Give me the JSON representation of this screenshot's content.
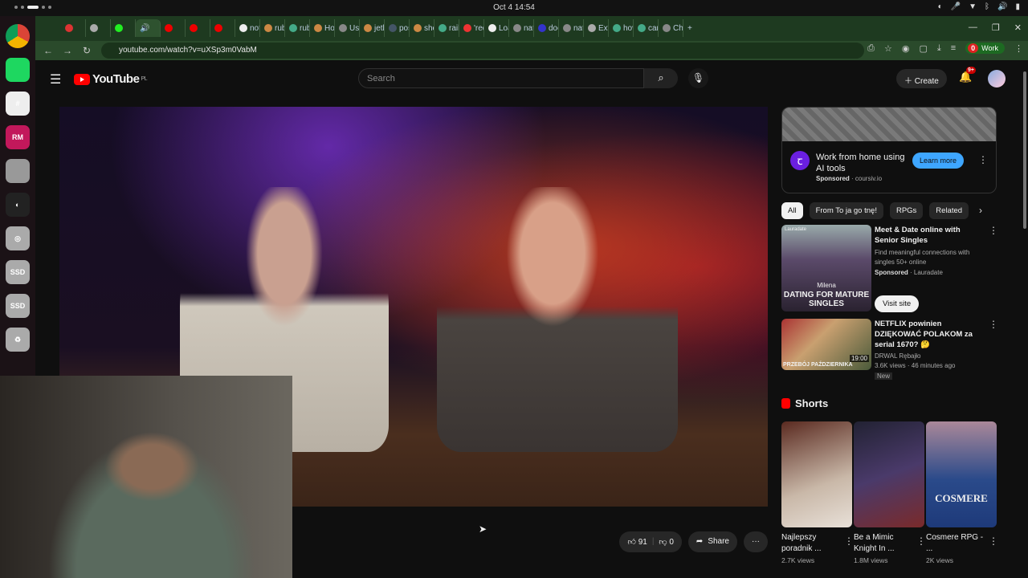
{
  "system": {
    "clock": "Oct 4  14:54",
    "tray": [
      "◐",
      "🎤",
      "▼",
      "ᛒ",
      "🔊",
      "▮"
    ]
  },
  "dock": [
    {
      "name": "chrome",
      "label": "",
      "color": "#ddd"
    },
    {
      "name": "spotify",
      "label": "",
      "color": "#1ed760"
    },
    {
      "name": "slack",
      "label": "#",
      "color": "#eee"
    },
    {
      "name": "rubymine",
      "label": "RM",
      "color": "#c2185b"
    },
    {
      "name": "files",
      "label": "",
      "color": "#999"
    },
    {
      "name": "obs",
      "label": "◐",
      "color": "#222"
    },
    {
      "name": "disc",
      "label": "◎",
      "color": "#aaa"
    },
    {
      "name": "ssd-1",
      "label": "SSD",
      "color": "#aaa"
    },
    {
      "name": "ssd-2",
      "label": "SSD",
      "color": "#aaa"
    },
    {
      "name": "trash",
      "label": "♻",
      "color": "#aaa"
    }
  ],
  "browser": {
    "tabs": [
      {
        "label": "",
        "icon": "#d33"
      },
      {
        "label": "",
        "icon": "#aaa"
      },
      {
        "label": "",
        "icon": "#2e2"
      },
      {
        "label": "🔊",
        "icon": "",
        "active": true
      },
      {
        "label": "",
        "icon": "#e00"
      },
      {
        "label": "",
        "icon": "#e00"
      },
      {
        "label": "",
        "icon": "#e00"
      },
      {
        "label": "not",
        "icon": "#eee"
      },
      {
        "label": "rub",
        "icon": "#c84"
      },
      {
        "label": "rub",
        "icon": "#4a8"
      },
      {
        "label": "Hov",
        "icon": "#c84"
      },
      {
        "label": "Ust",
        "icon": "#888"
      },
      {
        "label": "jetb",
        "icon": "#c84"
      },
      {
        "label": "pos",
        "icon": "#456"
      },
      {
        "label": "she",
        "icon": "#c84"
      },
      {
        "label": "rails",
        "icon": "#4a8"
      },
      {
        "label": "'req",
        "icon": "#e33"
      },
      {
        "label": "Loa",
        "icon": "#eee"
      },
      {
        "label": "nat",
        "icon": "#888"
      },
      {
        "label": "doc",
        "icon": "#33c"
      },
      {
        "label": "nat",
        "icon": "#888"
      },
      {
        "label": "Extr",
        "icon": "#aaa"
      },
      {
        "label": "hov",
        "icon": "#4a8"
      },
      {
        "label": "can",
        "icon": "#4a8"
      },
      {
        "label": "Cha",
        "icon": "#888"
      }
    ],
    "new_tab": "+",
    "url": "youtube.com/watch?v=uXSp3m0VabM",
    "profile": {
      "badge": "0",
      "label": "Work"
    }
  },
  "youtube": {
    "logo": "YouTube",
    "region": "PL",
    "search_placeholder": "Search",
    "create": "Create",
    "notif_count": "9+",
    "video": {
      "likes": "91",
      "dislikes": "0",
      "share": "Share",
      "more": "···"
    },
    "ad": {
      "title": "Work from home using AI tools",
      "sponsored": "Sponsored",
      "domain": "coursiv.io",
      "cta": "Learn more",
      "logo": "ꞇ"
    },
    "chips": [
      "All",
      "From To ja go tnę!",
      "RPGs",
      "Related"
    ],
    "recs": [
      {
        "title": "Meet & Date online with Senior Singles",
        "desc": "Find meaningful connections with singles 50+ online",
        "sponsored": "Sponsored",
        "advertiser": "Lauradate",
        "cta": "Visit site",
        "thumb_top": "Lauradate",
        "thumb_name": "Milena",
        "thumb_caption": "DATING FOR MATURE SINGLES"
      },
      {
        "title": "NETFLIX powinien DZIĘKOWAĆ POLAKOM za serial 1670? 🤔",
        "channel": "DRWAL Rębajło",
        "meta": "3.6K views · 46 minutes ago",
        "badge": "New",
        "duration": "19:00",
        "thumb_caption": "PRZEBÓJ PAŹDZIERNIKA"
      }
    ],
    "shorts_title": "Shorts",
    "shorts": [
      {
        "title": "Najlepszy poradnik ...",
        "views": "2.7K views",
        "color": "linear-gradient(160deg,#5a2a20,#c9b8a8 60%,#e8e0d8)"
      },
      {
        "title": "Be a Mimic Knight In ...",
        "views": "1.8M views",
        "color": "linear-gradient(160deg,#223,#4a3a6a 50%,#7a2a2a)"
      },
      {
        "title": "Cosmere RPG - ...",
        "views": "2K views",
        "color": "linear-gradient(180deg,#a89,#2a4a8a 55%,#1e3a7a)",
        "caption": "COSMERE"
      }
    ]
  }
}
